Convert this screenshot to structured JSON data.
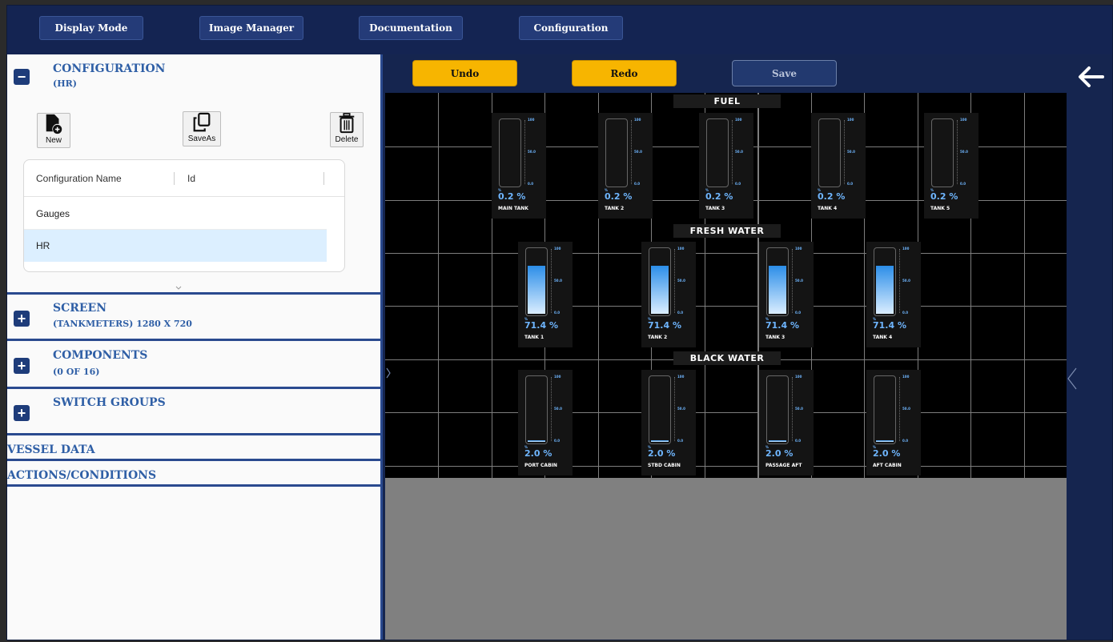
{
  "nav": {
    "display_mode": "Display Mode",
    "image_manager": "Image Manager",
    "documentation": "Documentation",
    "configuration": "Configuration"
  },
  "left": {
    "configuration": {
      "title": "CONFIGURATION",
      "subtitle": "(HR)",
      "toggle": "−",
      "new_label": "New",
      "saveas_label": "SaveAs",
      "delete_label": "Delete",
      "columns": [
        "Configuration Name",
        "Id"
      ],
      "rows": [
        "Gauges",
        "HR"
      ],
      "selected_row": "HR"
    },
    "screen": {
      "title": "SCREEN",
      "subtitle": "(TANKMETERS) 1280 X 720",
      "toggle": "+"
    },
    "components": {
      "title": "COMPONENTS",
      "subtitle": "(0 OF 16)",
      "toggle": "+"
    },
    "switch_groups": {
      "title": "SWITCH GROUPS",
      "toggle": "+"
    },
    "vessel_data": "VESSEL DATA",
    "actions_conditions": "ACTIONS/CONDITIONS"
  },
  "toolbar": {
    "undo": "Undo",
    "redo": "Redo",
    "save": "Save"
  },
  "colors": {
    "accent_orange": "#f7b500",
    "nav_blue": "#142452",
    "section_blue": "#2f5fa6",
    "gauge_value": "#6fb6ff"
  },
  "scale_labels": {
    "max": "100",
    "mid": "50.0",
    "min": "0.0",
    "unit": "%"
  },
  "groups": {
    "fuel": {
      "title": "FUEL",
      "tanks": [
        {
          "name": "MAIN TANK",
          "pct": "0.2 %",
          "level": 0.002
        },
        {
          "name": "TANK 2",
          "pct": "0.2 %",
          "level": 0.002
        },
        {
          "name": "TANK 3",
          "pct": "0.2 %",
          "level": 0.002
        },
        {
          "name": "TANK 4",
          "pct": "0.2 %",
          "level": 0.002
        },
        {
          "name": "TANK 5",
          "pct": "0.2 %",
          "level": 0.002
        }
      ]
    },
    "fresh_water": {
      "title": "FRESH WATER",
      "tanks": [
        {
          "name": "TANK 1",
          "pct": "71.4 %",
          "level": 0.714
        },
        {
          "name": "TANK 2",
          "pct": "71.4 %",
          "level": 0.714
        },
        {
          "name": "TANK 3",
          "pct": "71.4 %",
          "level": 0.714
        },
        {
          "name": "TANK 4",
          "pct": "71.4 %",
          "level": 0.714
        }
      ]
    },
    "black_water": {
      "title": "BLACK WATER",
      "tanks": [
        {
          "name": "PORT CABIN",
          "pct": "2.0 %",
          "level": 0.02
        },
        {
          "name": "STBD CABIN",
          "pct": "2.0 %",
          "level": 0.02
        },
        {
          "name": "PASSAGE AFT",
          "pct": "2.0 %",
          "level": 0.02
        },
        {
          "name": "AFT CABIN",
          "pct": "2.0 %",
          "level": 0.02
        }
      ]
    }
  }
}
